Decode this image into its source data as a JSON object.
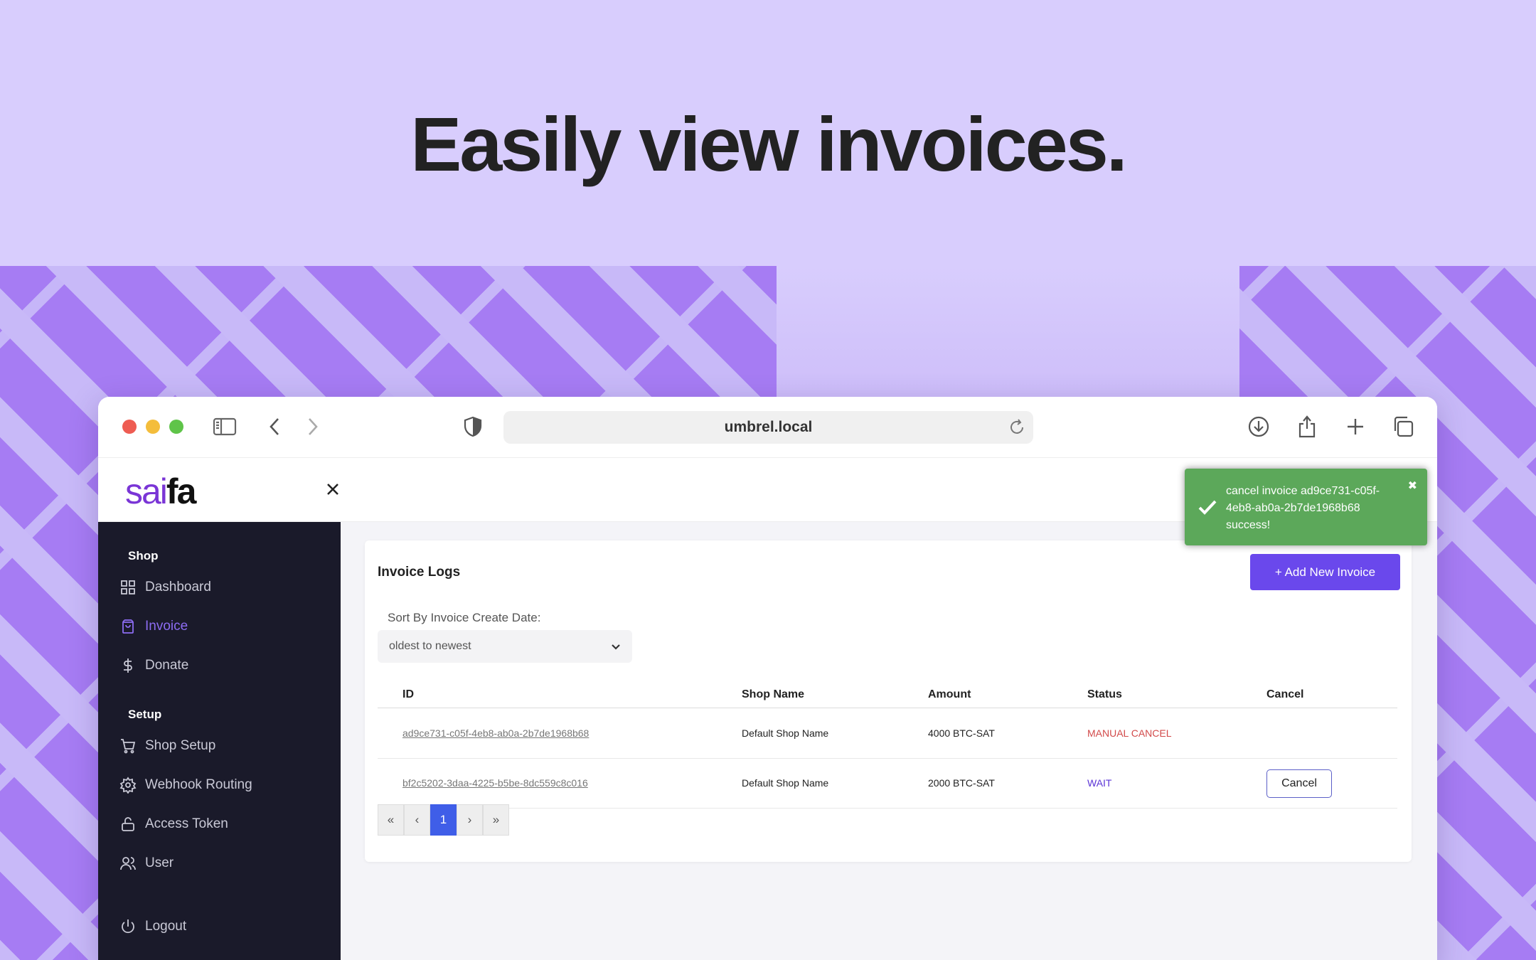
{
  "hero": {
    "title": "Easily view invoices."
  },
  "browser": {
    "url": "umbrel.local"
  },
  "app": {
    "logo_left": "sai",
    "logo_right": "fa"
  },
  "sidebar": {
    "sections": [
      {
        "label": "Shop"
      },
      {
        "label": "Setup"
      }
    ],
    "items": [
      {
        "label": "Dashboard",
        "icon": "grid-icon"
      },
      {
        "label": "Invoice",
        "icon": "bag-icon",
        "active": true
      },
      {
        "label": "Donate",
        "icon": "dollar-icon"
      },
      {
        "label": "Shop Setup",
        "icon": "cart-icon"
      },
      {
        "label": "Webhook Routing",
        "icon": "gear-icon"
      },
      {
        "label": "Access Token",
        "icon": "unlock-icon"
      },
      {
        "label": "User",
        "icon": "users-icon"
      },
      {
        "label": "Logout",
        "icon": "power-icon"
      }
    ]
  },
  "invoices": {
    "title": "Invoice Logs",
    "add_label": "+ Add New Invoice",
    "sort_label": "Sort By Invoice Create Date:",
    "sort_value": "oldest to newest",
    "columns": [
      "ID",
      "Shop Name",
      "Amount",
      "Status",
      "Cancel"
    ],
    "rows": [
      {
        "id": "ad9ce731-c05f-4eb8-ab0a-2b7de1968b68",
        "shop": "Default Shop Name",
        "amount": "4000 BTC-SAT",
        "status": "MANUAL CANCEL"
      },
      {
        "id": "bf2c5202-3daa-4225-b5be-8dc559c8c016",
        "shop": "Default Shop Name",
        "amount": "2000 BTC-SAT",
        "status": "WAIT",
        "cancel_label": "Cancel"
      }
    ],
    "pager": {
      "first": "«",
      "prev": "‹",
      "current": "1",
      "next": "›",
      "last": "»"
    }
  },
  "toast": {
    "message": "cancel invoice ad9ce731-c05f-4eb8-ab0a-2b7de1968b68 success!",
    "close": "✖"
  },
  "colors": {
    "accent": "#6a48ec",
    "toast": "#5ca85a",
    "sidebar": "#1a1a2a",
    "manual_cancel": "#d24a4a",
    "wait": "#5b34d6"
  }
}
